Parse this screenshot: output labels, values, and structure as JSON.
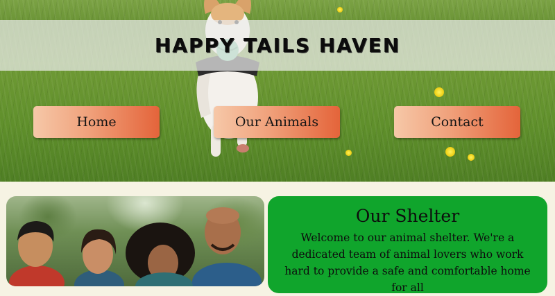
{
  "header": {
    "site_title": "HAPPY TAILS HAVEN"
  },
  "nav": {
    "items": [
      {
        "label": "Home"
      },
      {
        "label": "Our Animals"
      },
      {
        "label": "Contact"
      }
    ]
  },
  "about": {
    "heading": "Our Shelter",
    "body": "Welcome to our animal shelter. We're a dedicated team of animal lovers who work hard to provide a safe and comfortable home for all"
  },
  "colors": {
    "nav_button_gradient_start": "#f6c8a8",
    "nav_button_gradient_end": "#e4643a",
    "shelter_card_background": "#10a52c",
    "page_background": "#f6f3e3"
  }
}
